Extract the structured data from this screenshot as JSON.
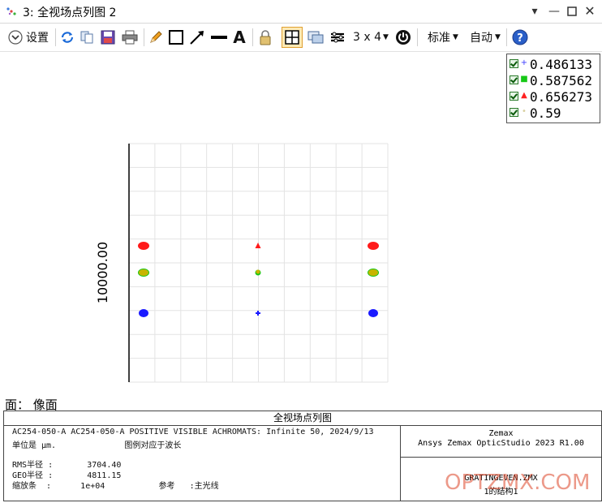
{
  "window": {
    "title": "3: 全视场点列图 2"
  },
  "toolbar": {
    "settings_label": "设置",
    "layout_label": "3 x 4",
    "standard_label": "标准",
    "auto_label": "自动"
  },
  "legend": [
    {
      "value": "0.486133",
      "marker": "+",
      "color": "#3a3aff"
    },
    {
      "value": "0.587562",
      "marker": "■",
      "color": "#16c816"
    },
    {
      "value": "0.656273",
      "marker": "▲",
      "color": "#ff2020"
    },
    {
      "value": "0.59",
      "marker": "•",
      "color": "#d8d0a0"
    }
  ],
  "plot": {
    "y_label": "10000.00",
    "surface_label": "面： 像面"
  },
  "chart_data": {
    "type": "scatter",
    "ylabel": "10000.00",
    "grid": true,
    "fields": [
      "left",
      "center",
      "right"
    ],
    "series": [
      {
        "name": "0.486133",
        "color": "#1a1aff"
      },
      {
        "name": "0.587562",
        "color": "#16c816"
      },
      {
        "name": "0.656273",
        "color": "#ff1a1a"
      },
      {
        "name": "0.59",
        "color": "#c8b400"
      }
    ]
  },
  "info": {
    "title": "全视场点列图",
    "line1": "AC254-050-A AC254-050-A POSITIVE VISIBLE ACHROMATS: Infinite 50, 2024/9/13",
    "line2": "单位是 μm.              图例对应于波长",
    "line3": "RMS半径 :       3704.40",
    "line4": "GEO半径 :       4811.15",
    "line5": "缩放条  :      1e+04           参考   :主光线",
    "company": "Zemax",
    "product": "Ansys Zemax OpticStudio 2023 R1.00",
    "file": "GRATINGEVEN.ZMX",
    "config": "1的结构1",
    "watermark": "OPTZMX.COM"
  }
}
